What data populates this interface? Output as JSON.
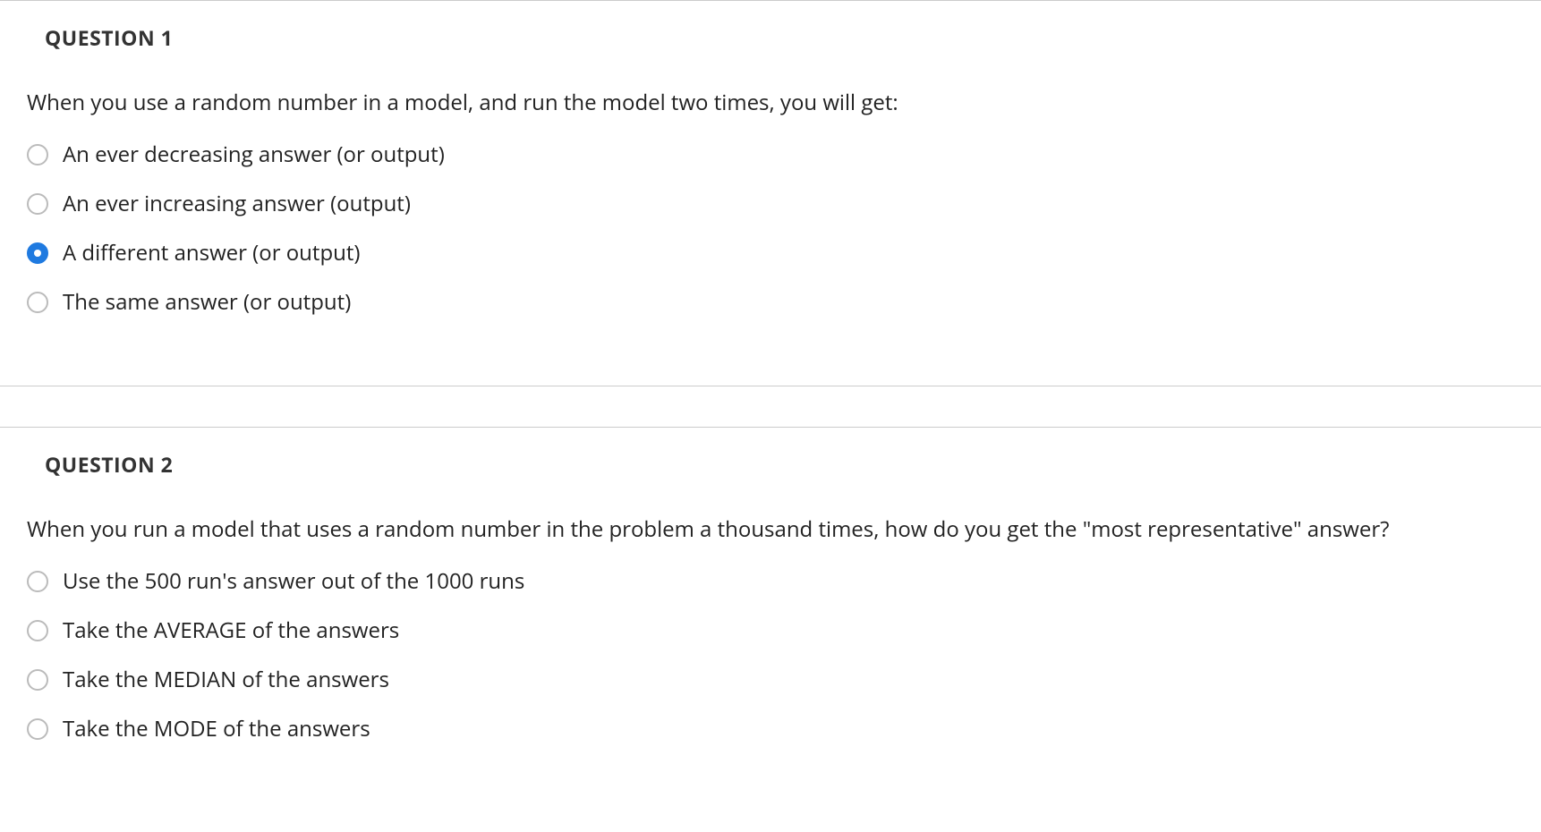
{
  "questions": [
    {
      "title": "QUESTION 1",
      "prompt": "When you use a random number in a model, and run the model two times, you will get:",
      "options": [
        {
          "label": "An ever decreasing answer (or output)",
          "selected": false
        },
        {
          "label": "An ever increasing answer (output)",
          "selected": false
        },
        {
          "label": "A different answer (or output)",
          "selected": true
        },
        {
          "label": "The same answer (or output)",
          "selected": false
        }
      ]
    },
    {
      "title": "QUESTION 2",
      "prompt": "When you run a model that uses a random number in the problem a thousand times, how do you get the \"most representative\" answer?",
      "options": [
        {
          "label": "Use the 500 run's answer out of the 1000 runs",
          "selected": false
        },
        {
          "label": "Take the AVERAGE of the answers",
          "selected": false
        },
        {
          "label": "Take the MEDIAN of the answers",
          "selected": false
        },
        {
          "label": "Take the MODE of the answers",
          "selected": false
        }
      ]
    }
  ]
}
